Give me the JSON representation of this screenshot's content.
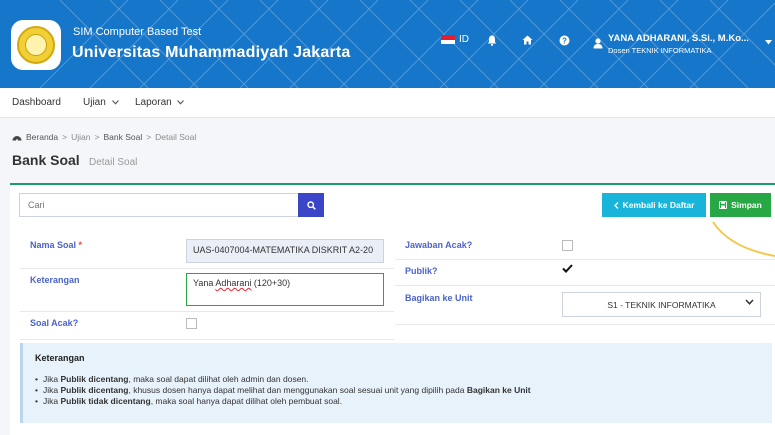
{
  "header": {
    "subtitle": "SIM Computer Based Test",
    "title": "Universitas Muhammadiyah Jakarta",
    "lang": "ID",
    "user_name": "YANA ADHARANI, S.Si., M.Ko...",
    "user_role": "Dosen TEKNIK INFORMATIKA"
  },
  "menu": {
    "dashboard": "Dashboard",
    "ujian": "Ujian",
    "laporan": "Laporan"
  },
  "breadcrumb": {
    "home": "Beranda",
    "ujian": "Ujian",
    "bank_soal": "Bank Soal",
    "detail": "Detail Soal"
  },
  "page": {
    "title": "Bank Soal",
    "subtitle": "Detail Soal"
  },
  "search": {
    "placeholder": "Cari"
  },
  "buttons": {
    "back": "Kembali ke Daftar",
    "save": "Simpan"
  },
  "form": {
    "nama_soal_label": "Nama Soal",
    "nama_soal_value": "UAS-0407004-MATEMATIKA DISKRIT A2-20",
    "keterangan_label": "Keterangan",
    "keterangan_value_a": "Yana ",
    "keterangan_value_b": "Adharani",
    "keterangan_value_c": " (120+30)",
    "soal_acak_label": "Soal Acak?",
    "soal_acak_checked": false,
    "jawaban_acak_label": "Jawaban Acak?",
    "jawaban_acak_checked": false,
    "publik_label": "Publik?",
    "publik_checked": true,
    "bagikan_label": "Bagikan ke Unit",
    "bagikan_value": "S1 - TEKNIK INFORMATIKA"
  },
  "note": {
    "title": "Keterangan",
    "items": [
      {
        "pre": "Jika ",
        "bold": "Publik dicentang",
        "post": ", maka soal dapat dilihat oleh admin dan dosen.",
        "bold2": ""
      },
      {
        "pre": "Jika ",
        "bold": "Publik dicentang",
        "post": ", khusus dosen hanya dapat melihat dan menggunakan soal sesuai unit yang dipilih pada ",
        "bold2": "Bagikan ke Unit"
      },
      {
        "pre": "Jika ",
        "bold": "Publik tidak dicentang",
        "post": ", maka soal hanya dapat dilihat oleh pembuat soal.",
        "bold2": ""
      }
    ]
  },
  "colors": {
    "header": "#1676c9",
    "label": "#4b63c6",
    "save": "#28a745",
    "back": "#19b4d9",
    "search": "#3b45c8"
  }
}
